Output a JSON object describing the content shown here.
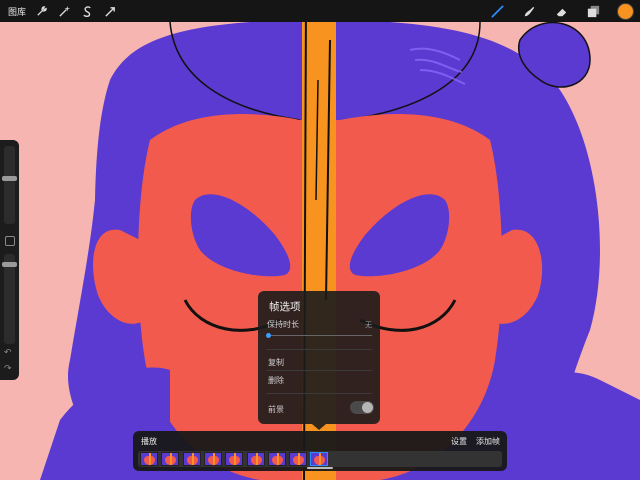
{
  "topbar": {
    "gallery_label": "图库",
    "left_tools": [
      {
        "name": "wrench-icon"
      },
      {
        "name": "magic-wand-icon"
      },
      {
        "name": "selection-s-icon"
      },
      {
        "name": "transform-arrow-icon"
      }
    ],
    "right_tools": [
      {
        "name": "brush-icon"
      },
      {
        "name": "smudge-icon"
      },
      {
        "name": "eraser-icon"
      },
      {
        "name": "layers-icon"
      }
    ],
    "active_color": "#f7931e"
  },
  "sidebar": {
    "undo_icon": "↶",
    "redo_icon": "↷"
  },
  "frame_options": {
    "title": "帧选项",
    "hold_duration_label": "保持时长",
    "hold_duration_value": "无",
    "duplicate_label": "复制",
    "delete_label": "删除",
    "foreground_label": "前景",
    "foreground_enabled": false,
    "hold_duration_level": 0
  },
  "timeline": {
    "play_label": "播放",
    "settings_label": "设置",
    "add_frame_label": "添加帧",
    "frame_count": 9,
    "selected_frame": 8
  },
  "colors": {
    "background": "#f6b5b0",
    "hair": "#5a3ad0",
    "face": "#f25a4e",
    "stripe": "#f7931e",
    "ink": "#111111"
  }
}
